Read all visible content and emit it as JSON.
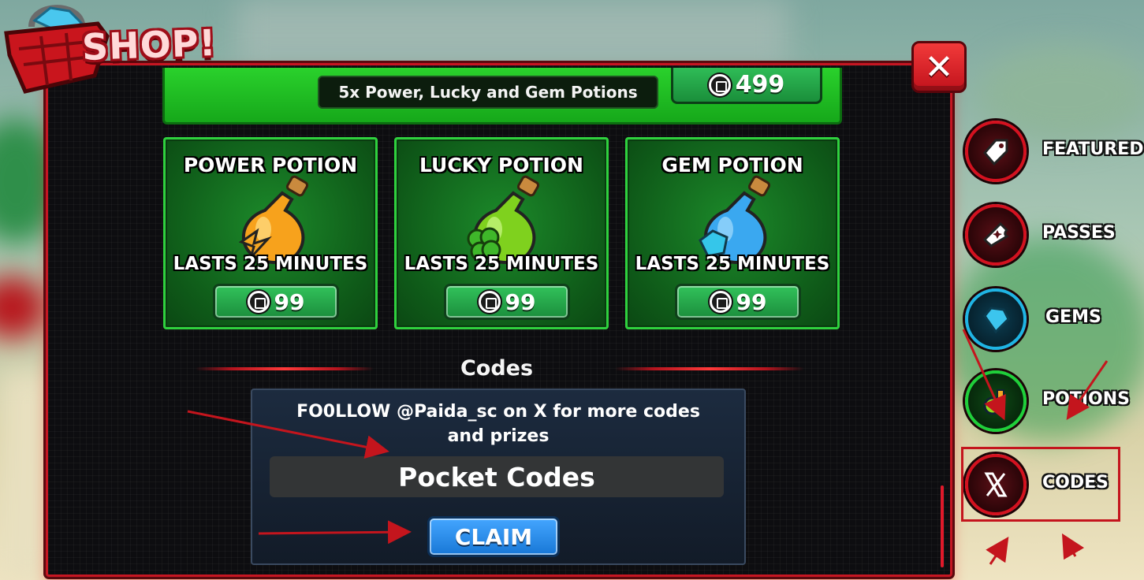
{
  "header": {
    "title": "SHOP!",
    "close_label": "✕"
  },
  "bundle": {
    "label": "5x Power, Lucky and Gem Potions",
    "price": "499"
  },
  "potions": [
    {
      "title": "POWER POTION",
      "duration": "LASTS 25 MINUTES",
      "price": "99",
      "color": "#f7a21c"
    },
    {
      "title": "LUCKY POTION",
      "duration": "LASTS 25 MINUTES",
      "price": "99",
      "color": "#7fd11e"
    },
    {
      "title": "GEM POTION",
      "duration": "LASTS 25 MINUTES",
      "price": "99",
      "color": "#3aa8f0"
    }
  ],
  "codes": {
    "heading": "Codes",
    "follow_line1": "FO0LLOW @Paida_sc on X for more codes",
    "follow_line2": "and prizes",
    "placeholder": "Pocket Codes",
    "claim_label": "CLAIM"
  },
  "sidebar": {
    "items": [
      {
        "label": "FEATURED",
        "icon": "tag-icon"
      },
      {
        "label": "PASSES",
        "icon": "ticket-icon"
      },
      {
        "label": "GEMS",
        "icon": "gem-icon"
      },
      {
        "label": "POTIONS",
        "icon": "potion-icon"
      },
      {
        "label": "CODES",
        "icon": "x-logo-icon"
      }
    ]
  },
  "colors": {
    "accent_red": "#c61622",
    "card_green": "#2fd13e",
    "claim_blue": "#1877d6",
    "annotation_red": "#c4151d"
  }
}
